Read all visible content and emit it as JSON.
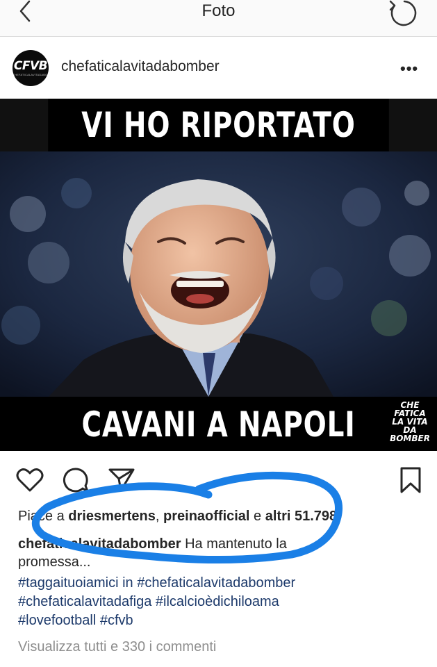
{
  "nav": {
    "title": "Foto"
  },
  "post": {
    "avatar_logo": "CFVB",
    "avatar_sub": "CHEFATICALAVITADABOMBER",
    "username": "chefaticalavitadabomber",
    "more": "•••"
  },
  "meme": {
    "top_text": "VI HO RIPORTATO",
    "bottom_text": "CAVANI A NAPOLI",
    "watermark": [
      "CHE",
      "FATICA",
      "LA VITA",
      "DA",
      "BOMBER"
    ]
  },
  "likes": {
    "prefix": "Piace a ",
    "user1": "driesmertens",
    "sep": ", ",
    "user2": "preinaofficial",
    "conj": " e ",
    "others": "altri 51.798"
  },
  "caption": {
    "username": "chefaticalavitadabomber",
    "text": " Ha mantenuto la",
    "text2": "promessa..."
  },
  "hashtags": {
    "line1_tag": "#taggaituoiamici",
    "line1_mid": " in ",
    "line1_tag2": "#chefaticalavitadabomber",
    "line2_tag1": "#chefaticalavitadafiga",
    "line2_tag2": "#ilcalcioèdichiloama",
    "line3_tag1": "#lovefootball",
    "line3_tag2": "#cfvb"
  },
  "comments_link": "Visualizza tutti e 330 i commenti",
  "colors": {
    "annotation": "#1a7fe6",
    "link": "#1d3a6b",
    "muted": "#8e8e8e"
  }
}
